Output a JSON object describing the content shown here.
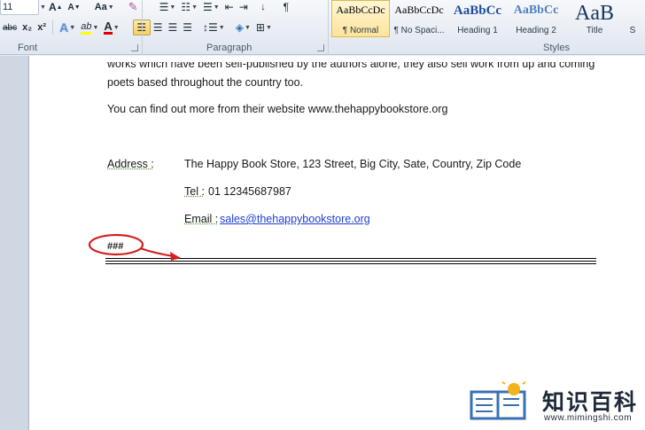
{
  "ribbon": {
    "font_group": {
      "label": "Font",
      "font_size": "11",
      "grow_font": "A",
      "shrink_font": "A",
      "change_case": "Aa",
      "strikethrough": "abc",
      "subscript": "x₂",
      "superscript": "x²",
      "text_effects": "A",
      "highlight": "ab",
      "font_color": "A"
    },
    "paragraph_group": {
      "label": "Paragraph",
      "sort": "↓",
      "pilcrow": "¶"
    },
    "styles_group": {
      "label": "Styles",
      "items": [
        {
          "preview": "AaBbCcDc",
          "name": "¶ Normal",
          "selected": true
        },
        {
          "preview": "AaBbCcDc",
          "name": "¶ No Spaci...",
          "selected": false
        },
        {
          "preview": "AaBbCc",
          "name": "Heading 1",
          "selected": false
        },
        {
          "preview": "AaBbCc",
          "name": "Heading 2",
          "selected": false
        },
        {
          "preview": "AaB",
          "name": "Title",
          "selected": false
        },
        {
          "preview": "",
          "name": "S",
          "selected": false
        }
      ]
    }
  },
  "document": {
    "line_partial": "works which have been self-published by the authors alone, they also sell work from up and coming",
    "line_2": "poets based throughout the country too.",
    "line_3": "You can find out more from their website www.thehappybookstore.org",
    "address_label": "Address :",
    "address_value": "The Happy Book Store, 123  Street, Big City, Sate, Country, Zip Code",
    "tel_label": "Tel :",
    "tel_value": "01  12345687987",
    "email_label": "Email :",
    "email_value": "sales@thehappybookstore.org",
    "end_marker": "###"
  },
  "watermark": {
    "text": "知识百科",
    "url": "www.mimingshi.com"
  },
  "colors": {
    "annotation": "#d42020",
    "link": "#1f3fd1",
    "accent": "#f8cf5d"
  }
}
